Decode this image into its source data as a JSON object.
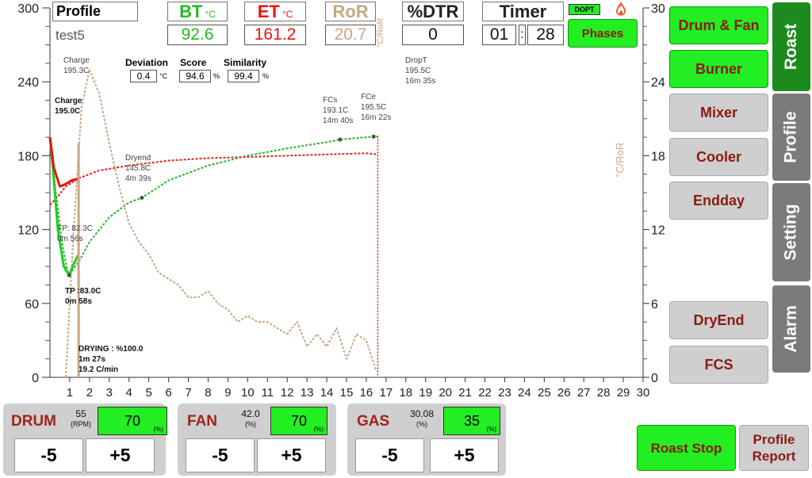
{
  "header": {
    "profile_label": "Profile",
    "profile_name": "test5",
    "bt_label": "BT",
    "bt_unit": "°C",
    "bt_value": "92.6",
    "et_label": "ET",
    "et_unit": "°C",
    "et_value": "161.2",
    "ror_label": "RoR",
    "ror_value": "20.7",
    "dtr_label": "%DTR",
    "dtr_value": "0",
    "timer_label": "Timer",
    "timer_min": "01",
    "timer_sep": ":",
    "timer_sec": "28",
    "dopt_label": "DOPT",
    "phases_label": "Phases"
  },
  "stats": {
    "deviation_label": "Deviation",
    "deviation_value": "0.4",
    "deviation_unit": "°C",
    "score_label": "Score",
    "score_value": "94.6",
    "score_unit": "%",
    "similarity_label": "Similarity",
    "similarity_value": "99.4",
    "similarity_unit": "%"
  },
  "annotations": {
    "charge_profile": [
      "Charge",
      "195.3C"
    ],
    "charge_live": [
      "Charge",
      "195.0C"
    ],
    "dryend": [
      "Dryend",
      "145.8C",
      "4m 39s"
    ],
    "tp_profile": [
      "TP: 82.3C",
      "0m 56s"
    ],
    "tp_live": [
      "TP :83.0C",
      "0m 58s"
    ],
    "fcs": [
      "FCs",
      "193.1C",
      "14m 40s"
    ],
    "fce": [
      "FCe",
      "195.5C",
      "16m 22s"
    ],
    "dropt": [
      "DropT",
      "195.5C",
      "16m 35s"
    ],
    "drying": [
      "DRYING : %100.0",
      "1m 27s",
      "19.2 C/min"
    ]
  },
  "axes": {
    "left_ticks": [
      "300",
      "240",
      "180",
      "120",
      "60",
      "0"
    ],
    "right_ticks": [
      "30",
      "24",
      "18",
      "12",
      "6",
      "0"
    ],
    "x_ticks": [
      "1",
      "2",
      "3",
      "4",
      "5",
      "6",
      "7",
      "8",
      "9",
      "10",
      "11",
      "12",
      "13",
      "14",
      "15",
      "16",
      "17",
      "18",
      "19",
      "20",
      "21",
      "22",
      "23",
      "24",
      "25",
      "26",
      "27",
      "28",
      "29",
      "30"
    ],
    "right_label": "°C/RoR"
  },
  "chart_data": {
    "type": "line",
    "xlabel": "",
    "ylabel": "",
    "xlim": [
      0,
      30
    ],
    "ylim": [
      0,
      300
    ],
    "y2lim": [
      0,
      30
    ],
    "y2label": "°C/RoR",
    "series": [
      {
        "name": "BT",
        "color": "#22bb22",
        "style": "dashed",
        "axis": "left",
        "x": [
          0,
          0.3,
          0.6,
          0.93,
          1.5,
          2,
          3,
          4,
          4.65,
          6,
          8,
          10,
          12,
          14,
          14.67,
          16,
          16.37,
          16.58
        ],
        "y": [
          195.3,
          150,
          110,
          82.3,
          95,
          110,
          130,
          142,
          145.8,
          160,
          172,
          180,
          186,
          191,
          193.1,
          195,
          195.5,
          195.5
        ]
      },
      {
        "name": "ET",
        "color": "#dd2222",
        "style": "dashed",
        "axis": "left",
        "x": [
          0,
          0.3,
          0.8,
          1.5,
          2.5,
          4,
          6,
          8,
          10,
          12,
          14,
          16,
          16.58
        ],
        "y": [
          140,
          145,
          155,
          162,
          168,
          172,
          176,
          178,
          179,
          180,
          181,
          182,
          181
        ]
      },
      {
        "name": "RoR",
        "color": "#c8a782",
        "style": "dashed",
        "axis": "right",
        "x": [
          0.8,
          1.2,
          1.6,
          2.0,
          2.5,
          3,
          3.5,
          4,
          4.5,
          5,
          5.5,
          6,
          6.5,
          7,
          7.5,
          8,
          8.5,
          9,
          9.5,
          10,
          10.5,
          11,
          11.5,
          12,
          12.5,
          13,
          13.5,
          14,
          14.5,
          15,
          15.5,
          16,
          16.5
        ],
        "y": [
          0,
          12,
          22,
          25,
          23,
          19,
          15.5,
          12.5,
          11,
          10,
          8.5,
          8,
          7.5,
          6.5,
          6.5,
          7,
          6,
          5.5,
          4.5,
          5,
          4.5,
          4.5,
          4,
          3.5,
          4.5,
          2.5,
          3.5,
          2.5,
          4,
          1.5,
          3.5,
          3,
          0.5
        ]
      },
      {
        "name": "BT live",
        "color": "#22cc22",
        "style": "solid",
        "axis": "left",
        "x": [
          0,
          0.15,
          0.4,
          0.7,
          0.97,
          1.2,
          1.45
        ],
        "y": [
          195,
          170,
          120,
          90,
          83,
          92,
          100
        ]
      },
      {
        "name": "ET live",
        "color": "#ee1111",
        "style": "solid",
        "axis": "left",
        "x": [
          0,
          0.2,
          0.5,
          0.8,
          1.1,
          1.45
        ],
        "y": [
          195,
          170,
          155,
          157,
          160,
          161.2
        ]
      }
    ]
  },
  "sidebar": {
    "buttons": [
      "Drum & Fan",
      "Burner",
      "Mixer",
      "Cooler",
      "Endday",
      "DryEnd",
      "FCS"
    ],
    "tabs": [
      "Roast",
      "Profile",
      "Setting",
      "Alarm"
    ]
  },
  "controls": {
    "drum": {
      "label": "DRUM",
      "reading": "55",
      "reading_unit": "(RPM)",
      "set": "70",
      "set_unit": "(%)",
      "minus": "-5",
      "plus": "+5"
    },
    "fan": {
      "label": "FAN",
      "reading": "42.0",
      "reading_unit": "(%)",
      "set": "70",
      "set_unit": "(%)",
      "minus": "-5",
      "plus": "+5"
    },
    "gas": {
      "label": "GAS",
      "reading": "30.08",
      "reading_unit": "(%)",
      "set": "35",
      "set_unit": "(%)",
      "minus": "-5",
      "plus": "+5"
    }
  },
  "actions": {
    "roast_stop": "Roast Stop",
    "profile_report_1": "Profile",
    "profile_report_2": "Report"
  },
  "colors": {
    "bt": "#22bb22",
    "et": "#dd2222",
    "ror": "#c8a782",
    "active_green": "#22ee22",
    "tab_active": "#1d8a1d",
    "tab_inactive": "#7b7b7b",
    "button_text": "#8b1a10"
  }
}
